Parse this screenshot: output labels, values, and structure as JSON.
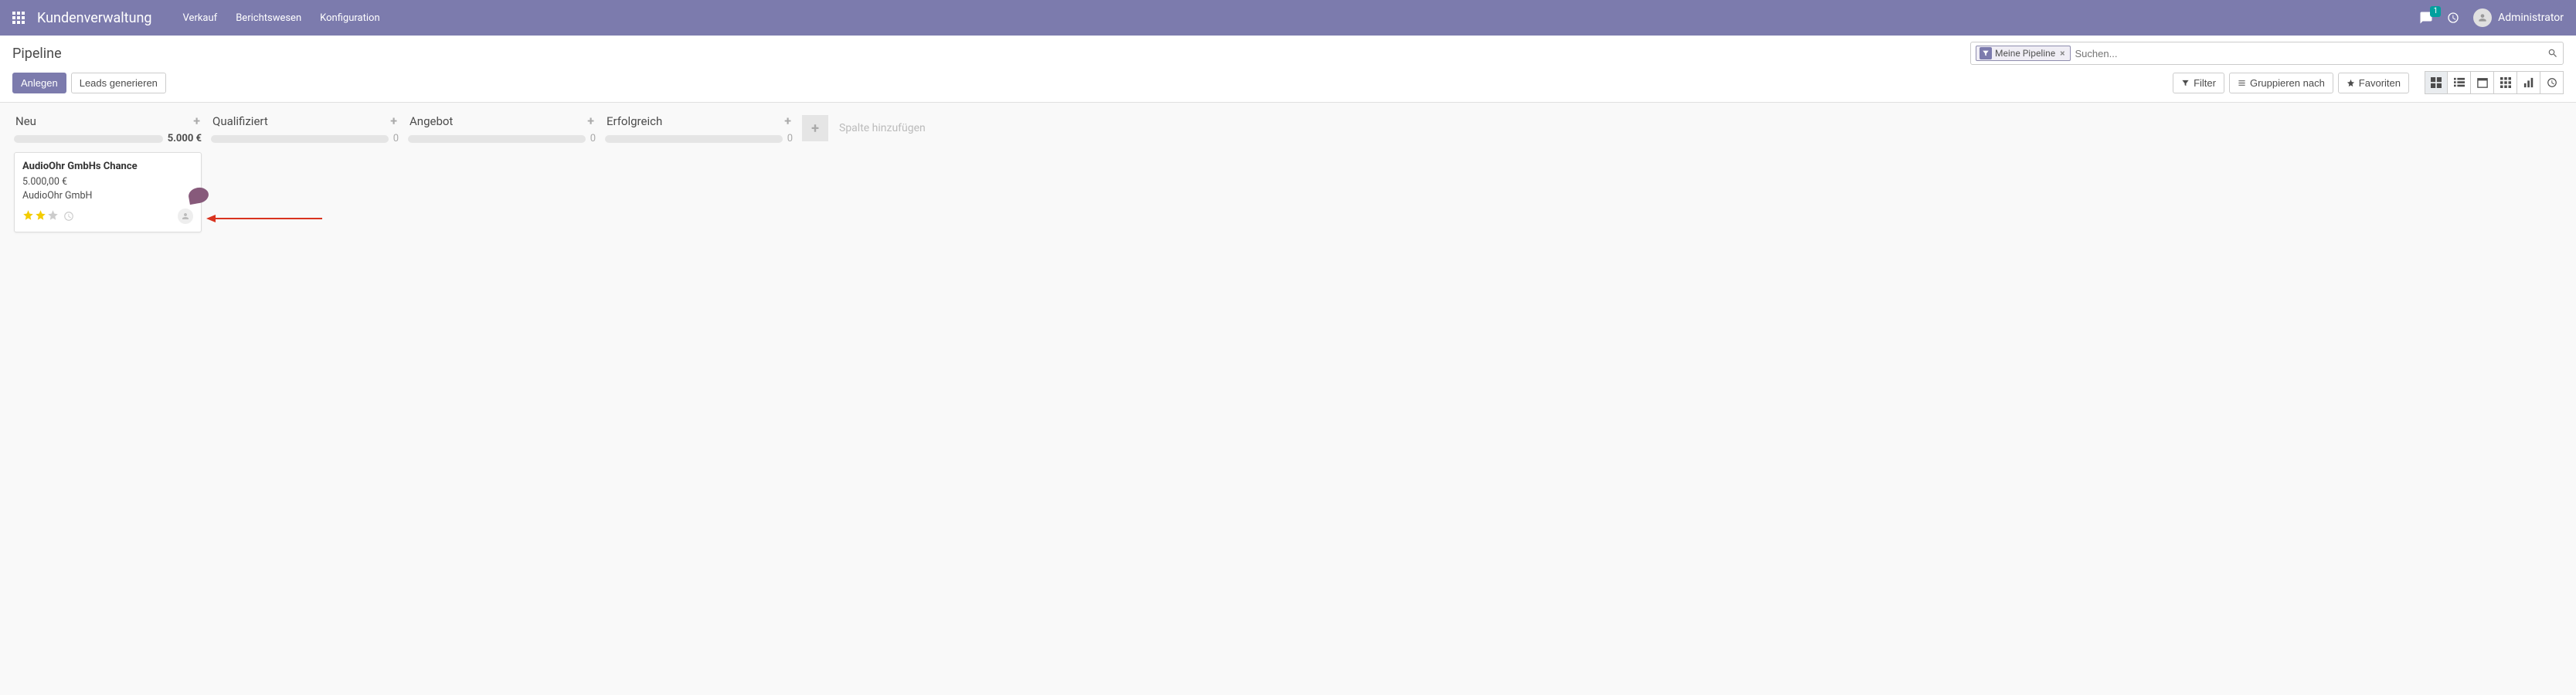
{
  "nav": {
    "app_title": "Kundenverwaltung",
    "menu": [
      "Verkauf",
      "Berichtswesen",
      "Konfiguration"
    ],
    "chat_badge": "1",
    "user_name": "Administrator"
  },
  "cp": {
    "breadcrumb": "Pipeline",
    "search_facet": "Meine Pipeline",
    "search_placeholder": "Suchen...",
    "btn_create": "Anlegen",
    "btn_generate": "Leads generieren",
    "btn_filter": "Filter",
    "btn_group": "Gruppieren nach",
    "btn_fav": "Favoriten"
  },
  "kanban": {
    "columns": [
      {
        "title": "Neu",
        "total": "5.000 €",
        "zero": false
      },
      {
        "title": "Qualifiziert",
        "total": "0",
        "zero": true
      },
      {
        "title": "Angebot",
        "total": "0",
        "zero": true
      },
      {
        "title": "Erfolgreich",
        "total": "0",
        "zero": true
      }
    ],
    "add_column": "Spalte hinzufügen",
    "card": {
      "title": "AudioOhr GmbHs Chance",
      "revenue": "5.000,00 €",
      "customer": "AudioOhr GmbH",
      "stars": 2
    }
  }
}
